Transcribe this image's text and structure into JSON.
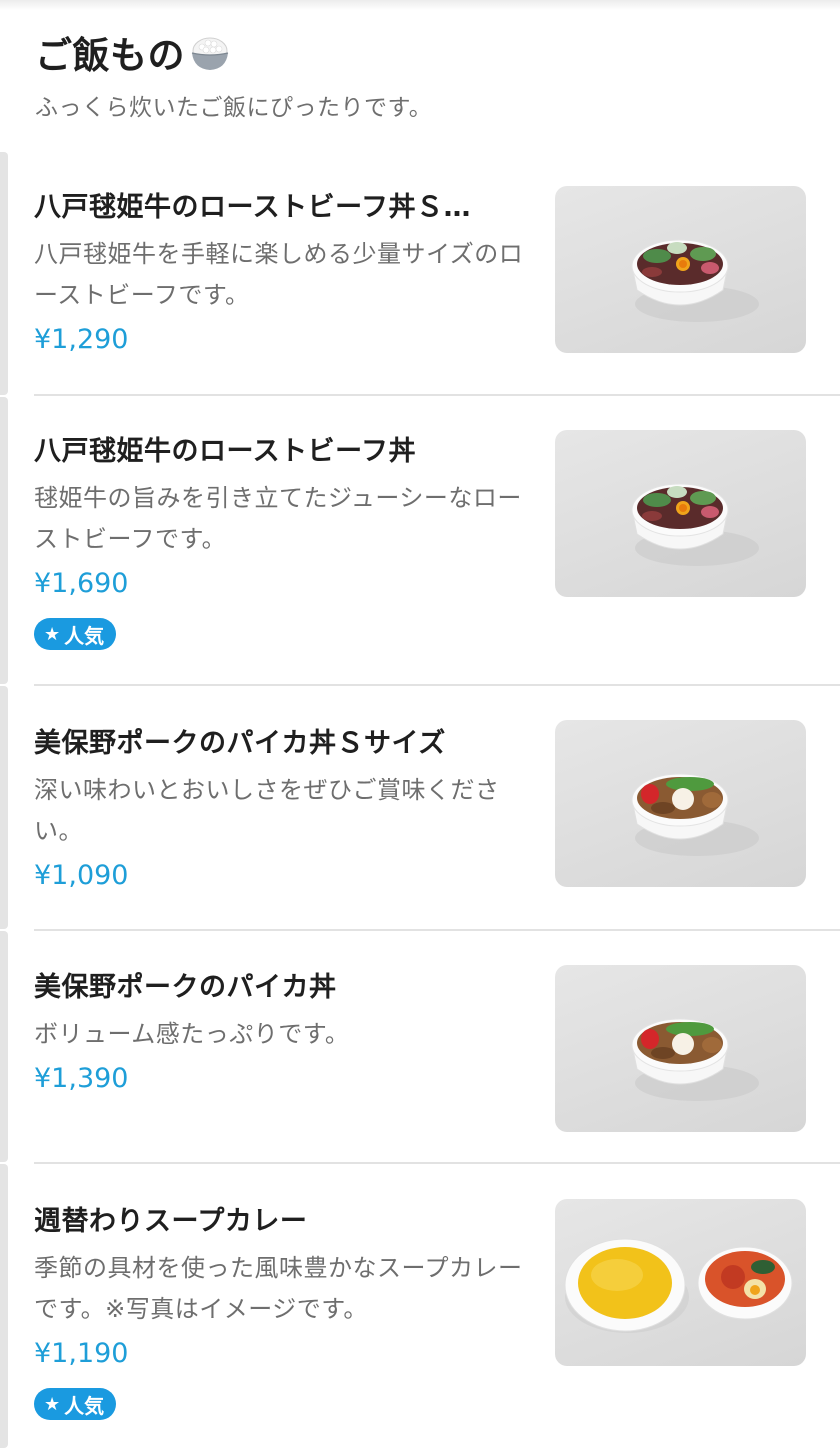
{
  "section": {
    "title": "ご飯もの",
    "subtitle": "ふっくら炊いたご飯にぴったりです。",
    "icon": "rice-bowl-icon"
  },
  "items": [
    {
      "name": "八戸毬姫牛のローストビーフ丼Ｓ…",
      "description": "八戸毬姫牛を手軽に楽しめる少量サイズのローストビーフです。",
      "price": "¥1,290",
      "badge": "",
      "image": "roast-beef-bowl-small"
    },
    {
      "name": "八戸毬姫牛のローストビーフ丼",
      "description": "毬姫牛の旨みを引き立てたジューシーなローストビーフです。",
      "price": "¥1,690",
      "badge": "人気",
      "image": "roast-beef-bowl"
    },
    {
      "name": "美保野ポークのパイカ丼Ｓサイズ",
      "description": "深い味わいとおいしさをぜひご賞味ください。",
      "price": "¥1,090",
      "badge": "",
      "image": "paika-bowl-small"
    },
    {
      "name": "美保野ポークのパイカ丼",
      "description": "ボリューム感たっぷりです。",
      "price": "¥1,390",
      "badge": "",
      "image": "paika-bowl"
    },
    {
      "name": "週替わりスープカレー",
      "description": "季節の具材を使った風味豊かなスープカレーです。※写真はイメージです。",
      "price": "¥1,190",
      "badge": "人気",
      "image": "soup-curry"
    }
  ],
  "colors": {
    "price": "#1e9ed8",
    "badge": "#1a9ae0"
  }
}
